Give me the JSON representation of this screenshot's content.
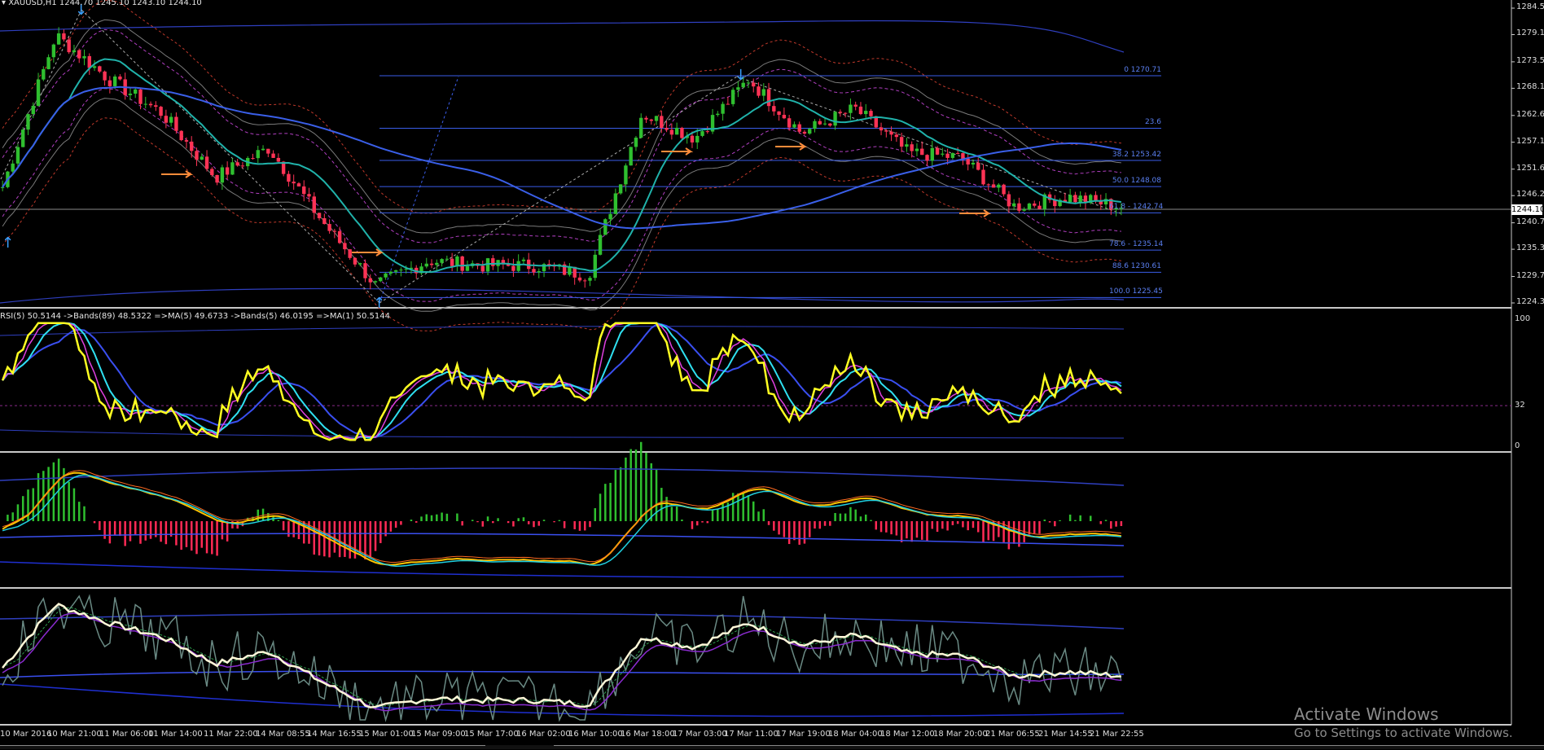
{
  "main": {
    "symbol": "XAUUSD,H1",
    "ohlc": "1244.70 1245.10 1243.10 1244.10",
    "current_price": "1244.10",
    "y_ticks": [
      "1284.50",
      "1279.10",
      "1273.55",
      "1268.15",
      "1262.60",
      "1257.15",
      "1251.65",
      "1246.25",
      "1240.70",
      "1235.30",
      "1229.75",
      "1224.35"
    ],
    "fib_labels": [
      "0 1270.71",
      "23.6",
      "38.2 1253.42",
      "50.0 1248.08",
      "61.8 - 1242.74",
      "78.6 - 1235.14",
      "88.6 1230.61",
      "100.0 1225.45"
    ],
    "colors": {
      "bull": "#2fbf2f",
      "bear": "#ff3355",
      "fib": "#3a5de8",
      "teal": "#20b2aa",
      "envelope": "#4040ff",
      "arrow_up": "#3aa0ff",
      "arrow_orange": "#ff8c3a"
    }
  },
  "rsi_panel": {
    "header": "RSI(5) 50.5144  ->Bands(89) 48.5322  =>MA(5) 49.6733  ->Bands(5) 46.0195  =>MA(1) 50.5144",
    "y_ticks": [
      "100",
      "32",
      "0"
    ]
  },
  "x_ticks": [
    "10 Mar 2016",
    "10 Mar 21:00",
    "11 Mar 06:00",
    "11 Mar 14:00",
    "11 Mar 22:00",
    "14 Mar 08:55",
    "14 Mar 16:55",
    "15 Mar 01:00",
    "15 Mar 09:00",
    "15 Mar 17:00",
    "16 Mar 02:00",
    "16 Mar 10:00",
    "16 Mar 18:00",
    "17 Mar 03:00",
    "17 Mar 11:00",
    "17 Mar 19:00",
    "18 Mar 04:00",
    "18 Mar 12:00",
    "18 Mar 20:00",
    "21 Mar 06:55",
    "21 Mar 14:55",
    "21 Mar 22:55"
  ],
  "watermark": {
    "line1": "Activate Windows",
    "line2": "Go to Settings to activate Windows."
  },
  "chart_data": {
    "type": "line",
    "title": "XAUUSD,H1",
    "x": [
      "10 Mar 2016",
      "10 Mar 21:00",
      "11 Mar 06:00",
      "11 Mar 14:00",
      "11 Mar 22:00",
      "14 Mar 08:55",
      "14 Mar 16:55",
      "15 Mar 01:00",
      "15 Mar 09:00",
      "15 Mar 17:00",
      "16 Mar 02:00",
      "16 Mar 10:00",
      "16 Mar 18:00",
      "17 Mar 03:00",
      "17 Mar 11:00",
      "17 Mar 19:00",
      "18 Mar 04:00",
      "18 Mar 12:00",
      "18 Mar 20:00",
      "21 Mar 06:55",
      "21 Mar 14:55",
      "21 Mar 22:55"
    ],
    "series": [
      {
        "name": "XAUUSD,H1",
        "values": [
          1248,
          1279,
          1270,
          1263,
          1250,
          1256,
          1241,
          1228,
          1233,
          1232,
          1232,
          1230,
          1263,
          1258,
          1270,
          1259,
          1264,
          1255,
          1254,
          1244,
          1246,
          1244
        ]
      }
    ],
    "ylim": [
      1224.35,
      1284.5
    ],
    "fib_levels": [
      1270.71,
      1260.0,
      1253.42,
      1248.08,
      1242.74,
      1235.14,
      1230.61,
      1225.45
    ],
    "grid": false
  }
}
